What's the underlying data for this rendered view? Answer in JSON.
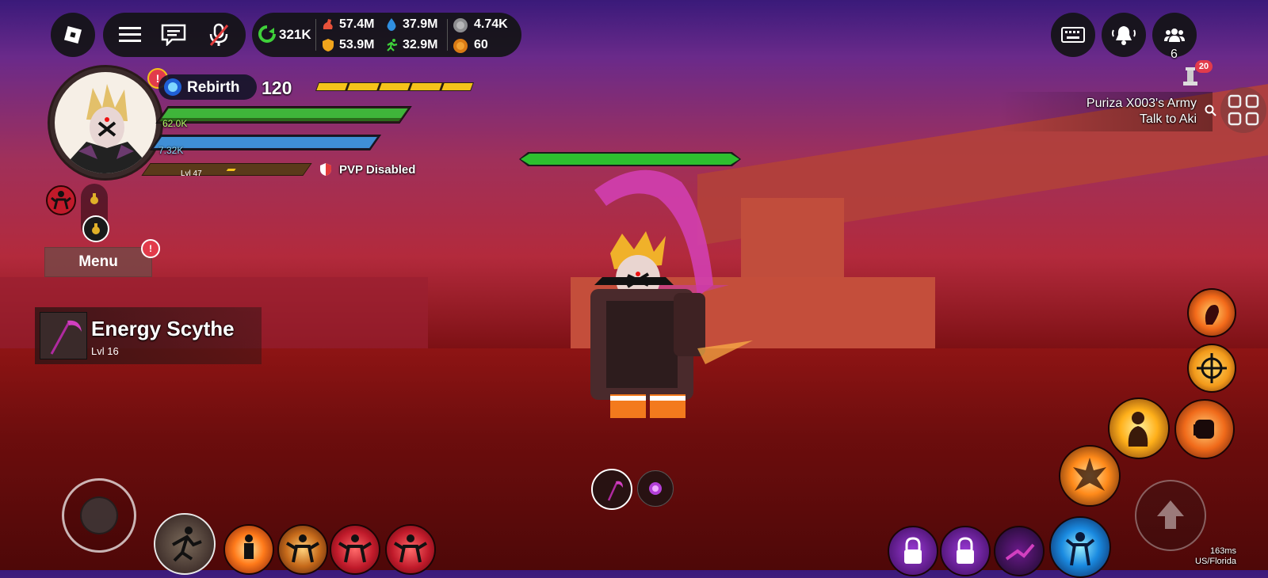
{
  "topbar": {
    "stats": {
      "rebirth_tokens": "321K",
      "strength": "57.4M",
      "chakra": "37.9M",
      "durability": "53.9M",
      "agility": "32.9M",
      "silver": "4.74K",
      "gold": "60"
    },
    "friends_count": "6",
    "notif_badge": "20"
  },
  "player": {
    "rebirth_label": "Rebirth",
    "rebirth_value": "120",
    "health_text": "62.0K",
    "energy_text": "7.32K",
    "level_text": "Lvl 47",
    "pvp_text": "PVP Disabled",
    "health_fraction": 1.0,
    "energy_fraction": 1.0,
    "xp_fraction": 0.05
  },
  "menu_label": "Menu",
  "equipped": {
    "name": "Energy Scythe",
    "level": "Lvl 16"
  },
  "quest": {
    "line1": "Puriza X003's Army",
    "line2": "Talk to Aki"
  },
  "network": {
    "ping": "163ms",
    "region": "US/Florida"
  },
  "colors": {
    "health": "#3fb53a",
    "energy": "#3f8fd6",
    "rebirth_bar": "#f5c21a",
    "accent_pink": "#e23fb5"
  }
}
